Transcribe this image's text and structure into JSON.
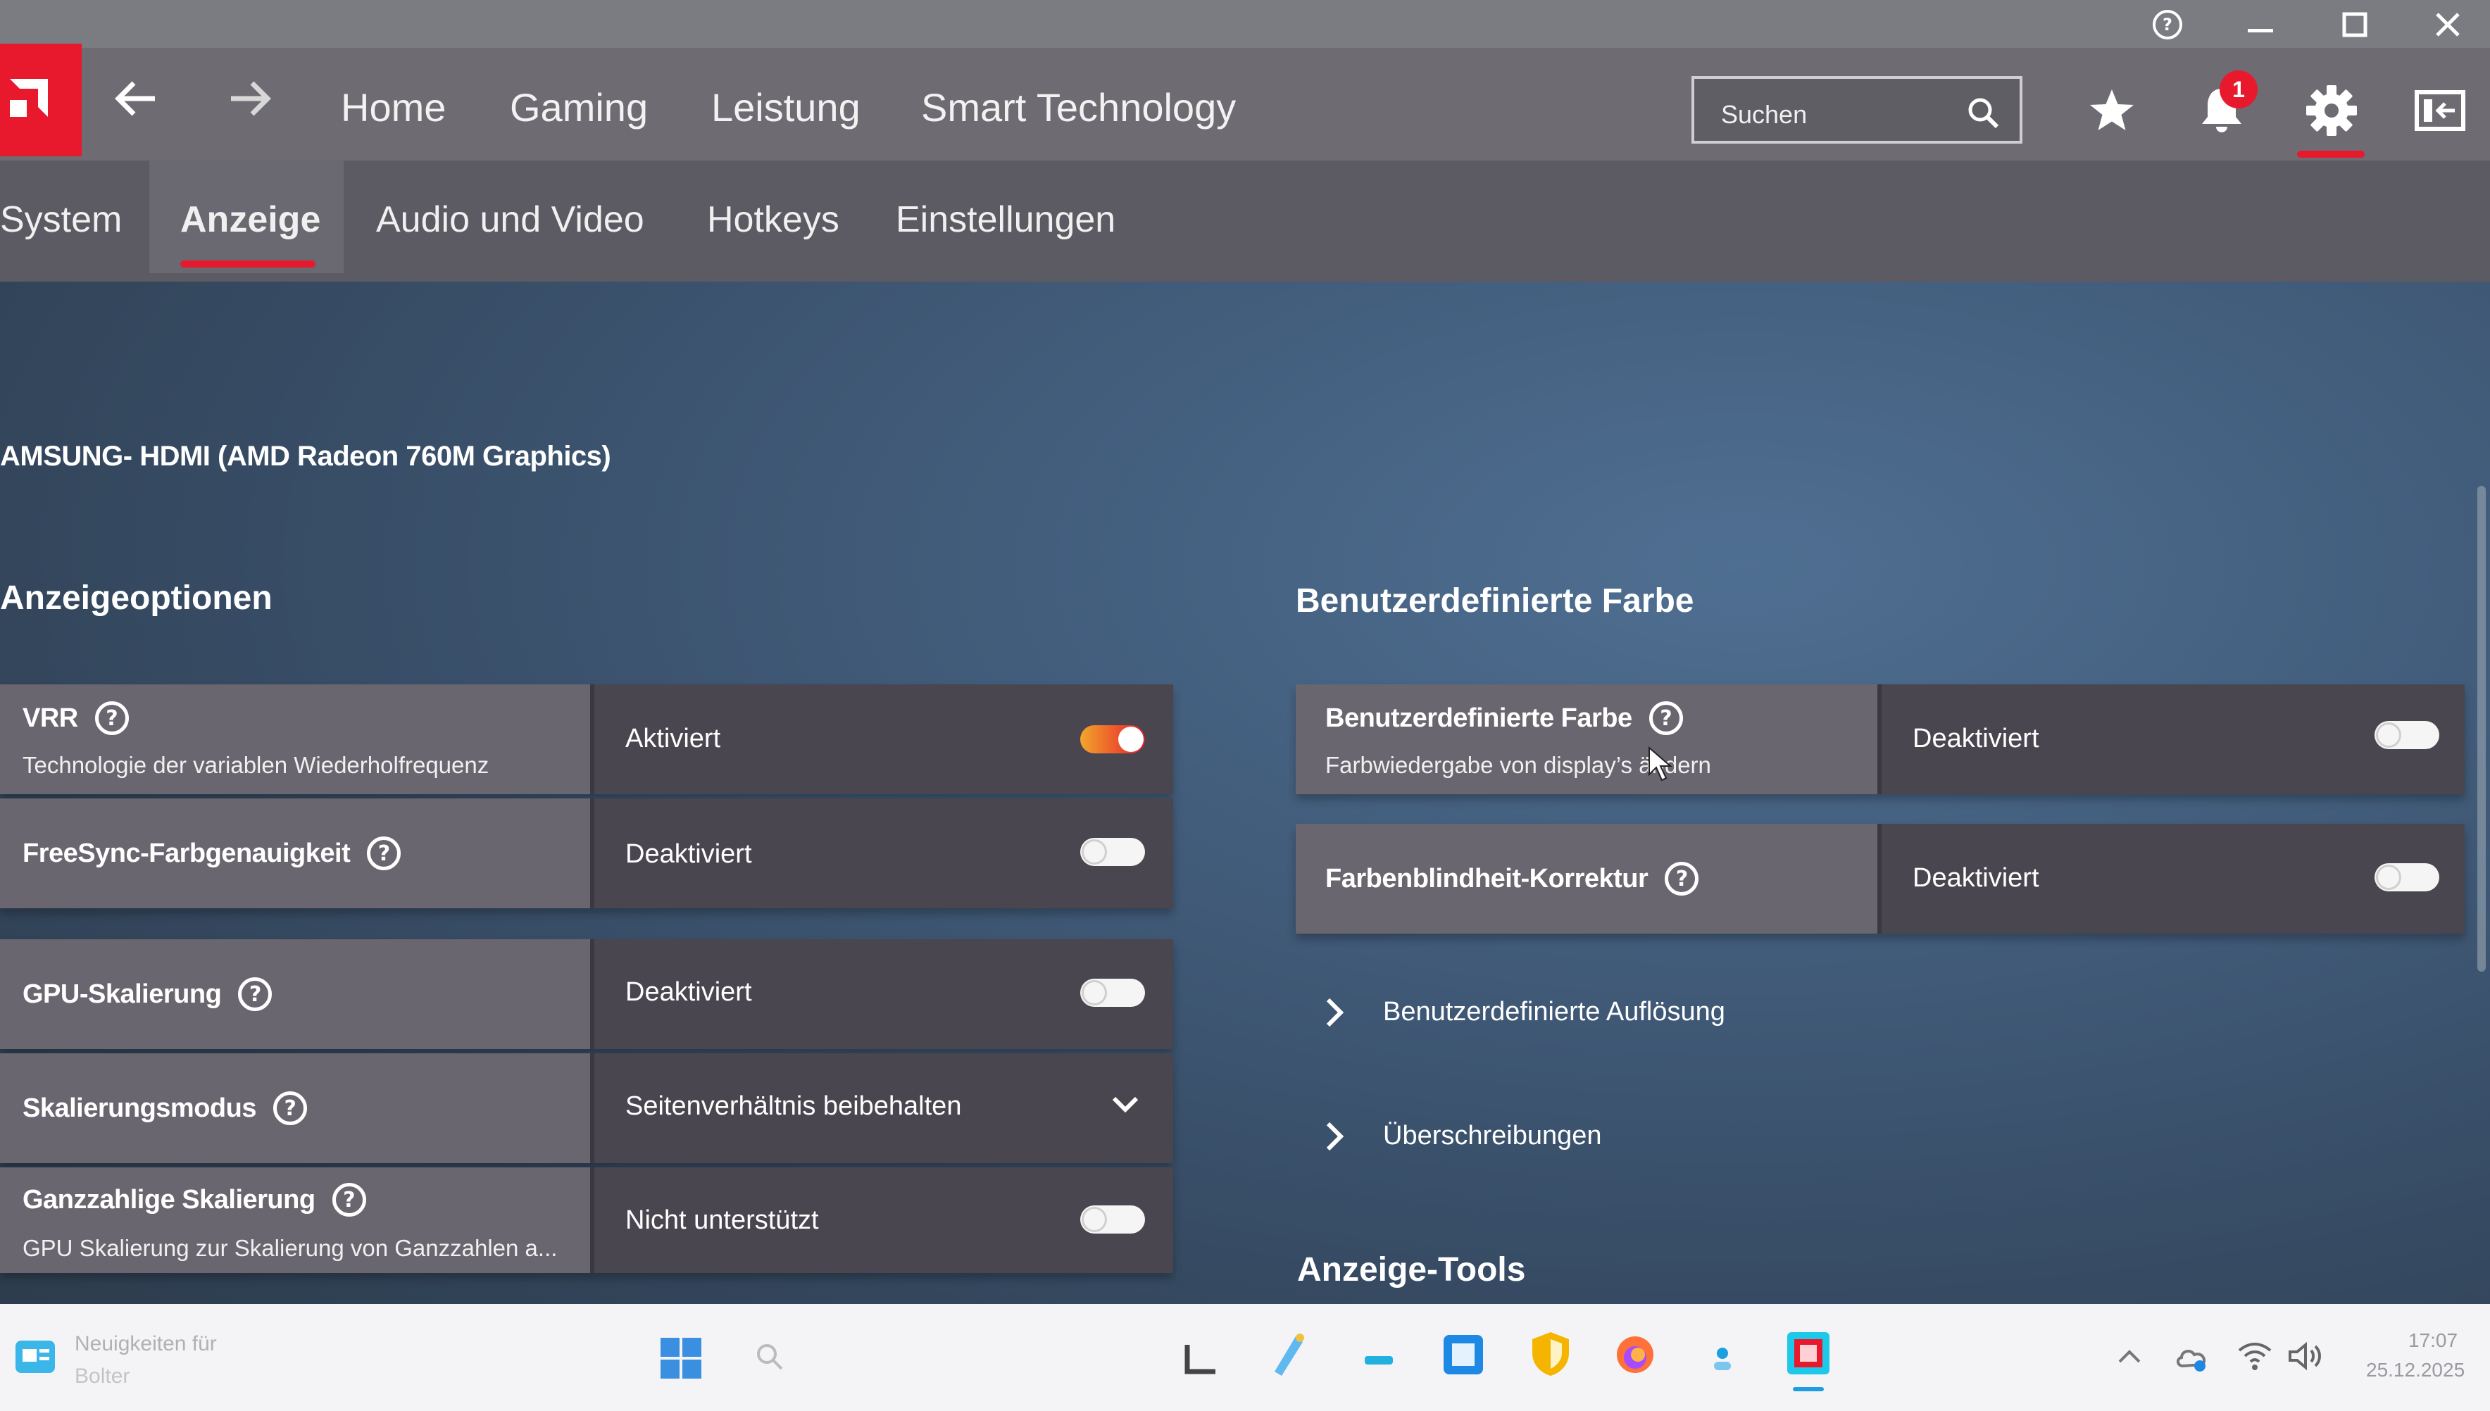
{
  "titlebar": {
    "help_icon": "help-circle-icon",
    "minimize_icon": "minimize-icon",
    "maximize_icon": "maximize-icon",
    "close_icon": "close-icon"
  },
  "nav": {
    "tabs": [
      "Home",
      "Gaming",
      "Leistung",
      "Smart Technology"
    ],
    "search_placeholder": "Suchen",
    "notification_count": "1",
    "accent": "#e8192c"
  },
  "subnav": {
    "tabs": [
      "System",
      "Anzeige",
      "Audio und Video",
      "Hotkeys",
      "Einstellungen"
    ],
    "active": "Anzeige"
  },
  "display": {
    "name": "AMSUNG- HDMI (AMD Radeon 760M Graphics)"
  },
  "left": {
    "title": "Anzeigeoptionen",
    "rows": [
      {
        "label": "VRR",
        "sub": "Technologie der variablen Wiederholfrequenz",
        "value": "Aktiviert",
        "control": "toggle-on"
      },
      {
        "label": "FreeSync-Farbgenauigkeit",
        "sub": "",
        "value": "Deaktiviert",
        "control": "toggle-off"
      },
      {
        "label": "GPU-Skalierung",
        "sub": "",
        "value": "Deaktiviert",
        "control": "toggle-off"
      },
      {
        "label": "Skalierungsmodus",
        "sub": "",
        "value": "Seitenverhältnis beibehalten",
        "control": "dropdown"
      },
      {
        "label": "Ganzzahlige Skalierung",
        "sub": "GPU Skalierung zur Skalierung von Ganzzahlen a...",
        "value": "Nicht unterstützt",
        "control": "toggle-off"
      }
    ]
  },
  "right": {
    "title": "Benutzerdefinierte Farbe",
    "rows": [
      {
        "label": "Benutzerdefinierte Farbe",
        "sub": "Farbwiedergabe von display’s ändern",
        "value": "Deaktiviert",
        "control": "toggle-off"
      },
      {
        "label": "Farbenblindheit-Korrektur",
        "sub": "",
        "value": "Deaktiviert",
        "control": "toggle-off"
      }
    ],
    "expanders": [
      "Benutzerdefinierte Auflösung",
      "Überschreibungen"
    ],
    "tools_title": "Anzeige-Tools"
  },
  "taskbar": {
    "news": "Neuigkeiten für",
    "news_sub": "Bolter",
    "time": "17:07",
    "date": "25.12.2025"
  }
}
